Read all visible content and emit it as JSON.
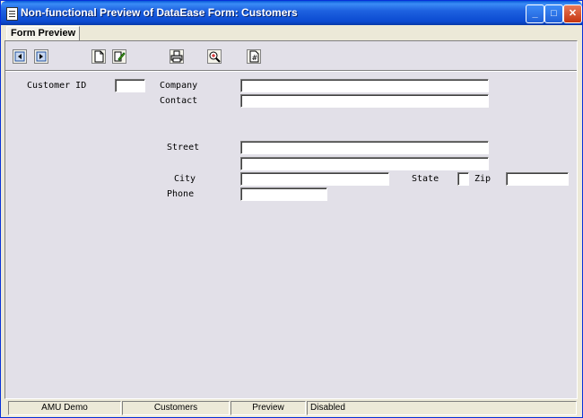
{
  "window": {
    "title": "Non-functional Preview of DataEase Form: Customers",
    "minimize_glyph": "_",
    "maximize_glyph": "□",
    "close_glyph": "✕"
  },
  "tabs": [
    {
      "label": "Form Preview"
    }
  ],
  "toolbar": {
    "icons": [
      "previous-record-icon",
      "next-record-icon",
      "new-document-icon",
      "edit-record-icon",
      "print-icon",
      "zoom-icon",
      "calculator-icon"
    ]
  },
  "form": {
    "customer_id_label": "Customer ID",
    "company_label": "Company",
    "contact_label": "Contact",
    "street_label": "Street",
    "city_label": "City",
    "state_label": "State",
    "zip_label": "Zip",
    "phone_label": "Phone"
  },
  "statusbar": {
    "panes": [
      "AMU Demo",
      "Customers",
      "Preview",
      "Disabled"
    ]
  }
}
